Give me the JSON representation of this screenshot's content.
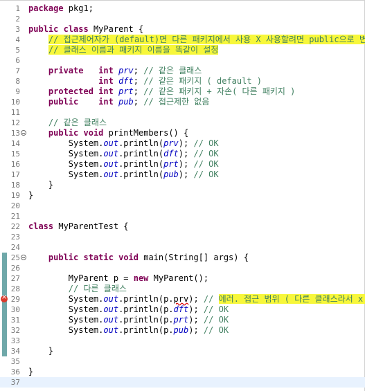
{
  "lines": [
    {
      "n": "1",
      "segs": [
        {
          "t": "package",
          "c": "kw"
        },
        {
          "t": " pkg1;"
        }
      ]
    },
    {
      "n": "2",
      "segs": []
    },
    {
      "n": "3",
      "segs": [
        {
          "t": "public",
          "c": "kw"
        },
        {
          "t": " "
        },
        {
          "t": "class",
          "c": "kw"
        },
        {
          "t": " MyParent {"
        }
      ]
    },
    {
      "n": "4",
      "segs": [
        {
          "t": "    "
        },
        {
          "t": "// 접근제어자가 (default)면 다른 패키지에서 사용 X 사용할려면 public으로 변경",
          "c": "cm hl"
        }
      ]
    },
    {
      "n": "5",
      "segs": [
        {
          "t": "    "
        },
        {
          "t": "// 클래스 이름과 패키지 이름을 똑같이 설정",
          "c": "cm hl"
        }
      ]
    },
    {
      "n": "6",
      "segs": []
    },
    {
      "n": "7",
      "segs": [
        {
          "t": "    "
        },
        {
          "t": "private",
          "c": "kw"
        },
        {
          "t": "   "
        },
        {
          "t": "int",
          "c": "kw"
        },
        {
          "t": " "
        },
        {
          "t": "prv",
          "c": "fi"
        },
        {
          "t": "; "
        },
        {
          "t": "// 같은 클래스",
          "c": "cm"
        }
      ]
    },
    {
      "n": "8",
      "segs": [
        {
          "t": "              "
        },
        {
          "t": "int",
          "c": "kw"
        },
        {
          "t": " "
        },
        {
          "t": "dft",
          "c": "fi"
        },
        {
          "t": "; "
        },
        {
          "t": "// 같은 패키지 ( default )",
          "c": "cm"
        }
      ]
    },
    {
      "n": "9",
      "segs": [
        {
          "t": "    "
        },
        {
          "t": "protected",
          "c": "kw"
        },
        {
          "t": " "
        },
        {
          "t": "int",
          "c": "kw"
        },
        {
          "t": " "
        },
        {
          "t": "prt",
          "c": "fi"
        },
        {
          "t": "; "
        },
        {
          "t": "// 같은 패키지 + 자손( 다른 패키지 )",
          "c": "cm"
        }
      ]
    },
    {
      "n": "10",
      "segs": [
        {
          "t": "    "
        },
        {
          "t": "public",
          "c": "kw"
        },
        {
          "t": "    "
        },
        {
          "t": "int",
          "c": "kw"
        },
        {
          "t": " "
        },
        {
          "t": "pub",
          "c": "fi"
        },
        {
          "t": "; "
        },
        {
          "t": "// 접근제한 없음",
          "c": "cm"
        }
      ]
    },
    {
      "n": "11",
      "segs": []
    },
    {
      "n": "12",
      "segs": [
        {
          "t": "    "
        },
        {
          "t": "// 같은 클래스",
          "c": "cm"
        }
      ]
    },
    {
      "n": "13",
      "fold": true,
      "segs": [
        {
          "t": "    "
        },
        {
          "t": "public",
          "c": "kw"
        },
        {
          "t": " "
        },
        {
          "t": "void",
          "c": "kw"
        },
        {
          "t": " printMembers() {"
        }
      ]
    },
    {
      "n": "14",
      "segs": [
        {
          "t": "        System."
        },
        {
          "t": "out",
          "c": "fi"
        },
        {
          "t": ".println("
        },
        {
          "t": "prv",
          "c": "fi"
        },
        {
          "t": "); "
        },
        {
          "t": "// OK",
          "c": "cm"
        }
      ]
    },
    {
      "n": "15",
      "segs": [
        {
          "t": "        System."
        },
        {
          "t": "out",
          "c": "fi"
        },
        {
          "t": ".println("
        },
        {
          "t": "dft",
          "c": "fi"
        },
        {
          "t": "); "
        },
        {
          "t": "// OK",
          "c": "cm"
        }
      ]
    },
    {
      "n": "16",
      "segs": [
        {
          "t": "        System."
        },
        {
          "t": "out",
          "c": "fi"
        },
        {
          "t": ".println("
        },
        {
          "t": "prt",
          "c": "fi"
        },
        {
          "t": "); "
        },
        {
          "t": "// OK",
          "c": "cm"
        }
      ]
    },
    {
      "n": "17",
      "segs": [
        {
          "t": "        System."
        },
        {
          "t": "out",
          "c": "fi"
        },
        {
          "t": ".println("
        },
        {
          "t": "pub",
          "c": "fi"
        },
        {
          "t": "); "
        },
        {
          "t": "// OK",
          "c": "cm"
        }
      ]
    },
    {
      "n": "18",
      "segs": [
        {
          "t": "    }"
        }
      ]
    },
    {
      "n": "19",
      "segs": [
        {
          "t": "}"
        }
      ]
    },
    {
      "n": "20",
      "segs": []
    },
    {
      "n": "21",
      "segs": []
    },
    {
      "n": "22",
      "segs": [
        {
          "t": "class",
          "c": "kw"
        },
        {
          "t": " MyParentTest {"
        }
      ]
    },
    {
      "n": "23",
      "segs": []
    },
    {
      "n": "24",
      "segs": []
    },
    {
      "n": "25",
      "fold": true,
      "mark": true,
      "segs": [
        {
          "t": "    "
        },
        {
          "t": "public",
          "c": "kw"
        },
        {
          "t": " "
        },
        {
          "t": "static",
          "c": "kw"
        },
        {
          "t": " "
        },
        {
          "t": "void",
          "c": "kw"
        },
        {
          "t": " main(String[] args) {"
        }
      ]
    },
    {
      "n": "26",
      "mark": true,
      "segs": []
    },
    {
      "n": "27",
      "mark": true,
      "segs": [
        {
          "t": "        MyParent p = "
        },
        {
          "t": "new",
          "c": "kw"
        },
        {
          "t": " MyParent();"
        }
      ]
    },
    {
      "n": "28",
      "mark": true,
      "segs": [
        {
          "t": "        "
        },
        {
          "t": "// 다른 클래스",
          "c": "cm"
        }
      ]
    },
    {
      "n": "29",
      "mark": true,
      "error": true,
      "segs": [
        {
          "t": "        System."
        },
        {
          "t": "out",
          "c": "fi"
        },
        {
          "t": ".println(p."
        },
        {
          "t": "prv",
          "c": "err-word"
        },
        {
          "t": "); "
        },
        {
          "t": "// ",
          "c": "cm"
        },
        {
          "t": "에러. 접근 범위 ( 다른 클래스라서 x )",
          "c": "cm hl"
        }
      ]
    },
    {
      "n": "30",
      "mark": true,
      "segs": [
        {
          "t": "        System."
        },
        {
          "t": "out",
          "c": "fi"
        },
        {
          "t": ".println(p."
        },
        {
          "t": "dft",
          "c": "fi"
        },
        {
          "t": "); "
        },
        {
          "t": "// OK",
          "c": "cm"
        }
      ]
    },
    {
      "n": "31",
      "mark": true,
      "segs": [
        {
          "t": "        System."
        },
        {
          "t": "out",
          "c": "fi"
        },
        {
          "t": ".println(p."
        },
        {
          "t": "prt",
          "c": "fi"
        },
        {
          "t": "); "
        },
        {
          "t": "// OK",
          "c": "cm"
        }
      ]
    },
    {
      "n": "32",
      "mark": true,
      "segs": [
        {
          "t": "        System."
        },
        {
          "t": "out",
          "c": "fi"
        },
        {
          "t": ".println(p."
        },
        {
          "t": "pub",
          "c": "fi"
        },
        {
          "t": "); "
        },
        {
          "t": "// OK",
          "c": "cm"
        }
      ]
    },
    {
      "n": "33",
      "mark": true,
      "segs": []
    },
    {
      "n": "34",
      "mark": true,
      "segs": [
        {
          "t": "    }"
        }
      ]
    },
    {
      "n": "35",
      "segs": []
    },
    {
      "n": "36",
      "segs": [
        {
          "t": "}"
        }
      ]
    },
    {
      "n": "37",
      "current": true,
      "segs": []
    }
  ]
}
